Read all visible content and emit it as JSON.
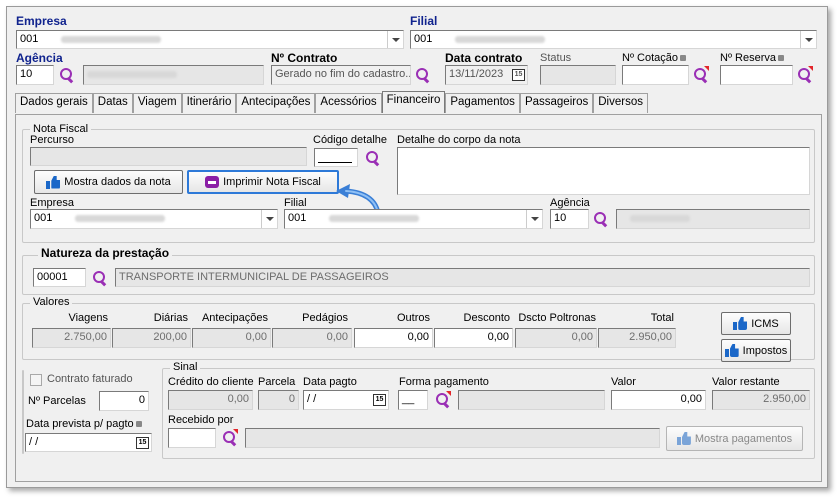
{
  "header": {
    "empresa_label": "Empresa",
    "empresa_value": "001",
    "filial_label": "Filial",
    "filial_value": "001",
    "agencia_label": "Agência",
    "agencia_value": "10",
    "contrato_label": "Nº Contrato",
    "contrato_value": "Gerado no fim do cadastro...",
    "data_contrato_label": "Data contrato",
    "data_contrato_value": "13/11/2023",
    "status_label": "Status",
    "cotacao_label": "Nº Cotação",
    "reserva_label": "Nº Reserva"
  },
  "tabs": [
    "Dados gerais",
    "Datas",
    "Viagem",
    "Itinerário",
    "Antecipações",
    "Acessórios",
    "Financeiro",
    "Pagamentos",
    "Passageiros",
    "Diversos"
  ],
  "active_tab": "Financeiro",
  "nota_fiscal": {
    "title": "Nota Fiscal",
    "percurso_label": "Percurso",
    "codigo_detalhe_label": "Código detalhe",
    "detalhe_label": "Detalhe do corpo da nota",
    "mostra_button": "Mostra dados da nota",
    "imprimir_button": "Imprimir Nota Fiscal",
    "empresa_label": "Empresa",
    "empresa_value": "001",
    "filial_label": "Filial",
    "filial_value": "001",
    "agencia_label": "Agência",
    "agencia_value": "10"
  },
  "natureza": {
    "title": "Natureza da prestação",
    "code": "00001",
    "description": "TRANSPORTE INTERMUNICIPAL DE PASSAGEIROS"
  },
  "valores": {
    "title": "Valores",
    "columns": [
      "Viagens",
      "Diárias",
      "Antecipações",
      "Pedágios",
      "Outros",
      "Desconto",
      "Dscto Poltronas",
      "Total"
    ],
    "values": [
      "2.750,00",
      "200,00",
      "0,00",
      "0,00",
      "0,00",
      "0,00",
      "0,00",
      "2.950,00"
    ],
    "icms_button": "ICMS",
    "impostos_button": "Impostos"
  },
  "faturamento": {
    "contrato_faturado_label": "Contrato faturado",
    "parcelas_label": "Nº Parcelas",
    "parcelas_value": "0",
    "data_prevista_label": "Data prevista p/ pagto",
    "data_prevista_value": "/ /"
  },
  "sinal": {
    "title": "Sinal",
    "credito_label": "Crédito do cliente",
    "credito_value": "0,00",
    "parcela_label": "Parcela",
    "parcela_value": "0",
    "data_pagto_label": "Data pagto",
    "data_pagto_value": "/ /",
    "forma_label": "Forma pagamento",
    "forma_value": "__",
    "valor_label": "Valor",
    "valor_value": "0,00",
    "restante_label": "Valor restante",
    "restante_value": "2.950,00",
    "recebido_label": "Recebido por",
    "mostra_pagamentos_button": "Mostra pagamentos"
  },
  "calendar_glyph": "15"
}
